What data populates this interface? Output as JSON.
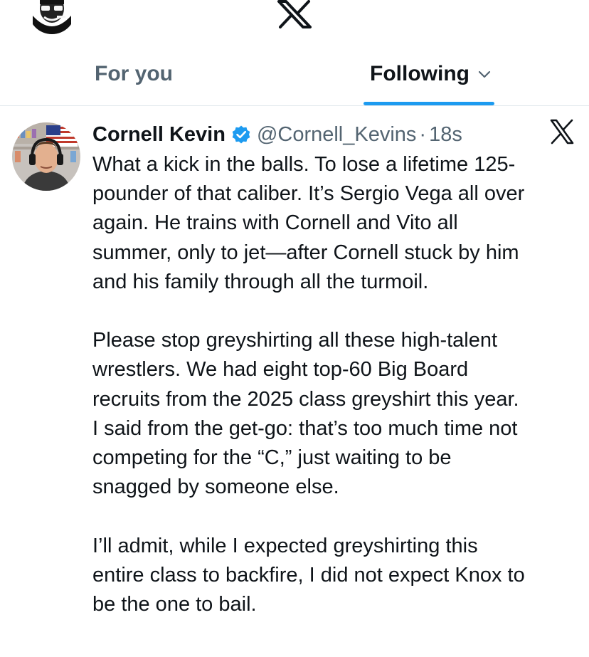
{
  "tabs": {
    "for_you": "For you",
    "following": "Following"
  },
  "post": {
    "display_name": "Cornell Kevin",
    "handle": "@Cornell_Kevins",
    "separator": "·",
    "time": "18s",
    "paragraphs": [
      "What a kick in the balls. To lose a lifetime 125-\npounder of that caliber. It’s Sergio Vega all over\nagain. He trains with Cornell and Vito all\nsummer, only to jet—after Cornell stuck by him\nand his family through all the turmoil.",
      "Please stop greyshirting all these high-talent\nwrestlers. We had eight top-60 Big Board\nrecruits from the 2025 class greyshirt this year.\nI said from the get-go: that’s too much time not\ncompeting for the “C,” just waiting to be\nsnagged by someone else.",
      "I’ll admit, while I expected greyshirting this\nentire class to backfire, I did not expect Knox to\nbe the one to bail."
    ]
  },
  "icons": {
    "app_logo": "x-logo-icon",
    "verified": "verified-badge-icon",
    "tab_menu": "chevron-down-icon",
    "post_source": "x-logo-icon"
  },
  "colors": {
    "accent": "#1d9bf0",
    "text_primary": "#0f1419",
    "text_secondary": "#536471",
    "divider": "#e1e8ed"
  }
}
